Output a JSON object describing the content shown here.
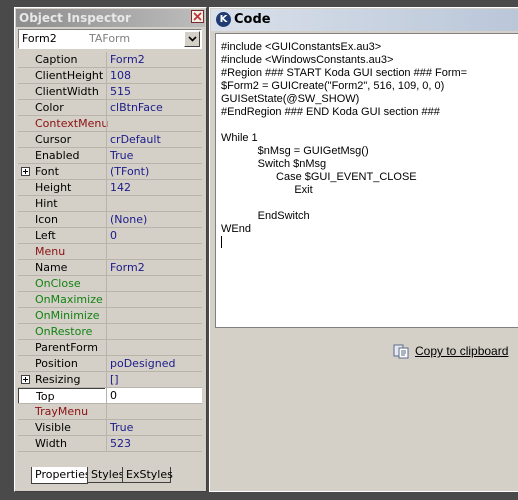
{
  "inspector": {
    "title": "Object Inspector",
    "selected_name": "Form2",
    "selected_type": "TAForm",
    "properties": [
      {
        "name": "Caption",
        "value": "Form2",
        "kind": "prop"
      },
      {
        "name": "ClientHeight",
        "value": "108",
        "kind": "prop"
      },
      {
        "name": "ClientWidth",
        "value": "515",
        "kind": "prop"
      },
      {
        "name": "Color",
        "value": "clBtnFace",
        "kind": "prop"
      },
      {
        "name": "ContextMenu",
        "value": "",
        "kind": "comp"
      },
      {
        "name": "Cursor",
        "value": "crDefault",
        "kind": "prop"
      },
      {
        "name": "Enabled",
        "value": "True",
        "kind": "prop"
      },
      {
        "name": "Font",
        "value": "(TFont)",
        "kind": "prop",
        "expandable": true
      },
      {
        "name": "Height",
        "value": "142",
        "kind": "prop"
      },
      {
        "name": "Hint",
        "value": "",
        "kind": "prop"
      },
      {
        "name": "Icon",
        "value": "(None)",
        "kind": "prop"
      },
      {
        "name": "Left",
        "value": "0",
        "kind": "prop"
      },
      {
        "name": "Menu",
        "value": "",
        "kind": "comp"
      },
      {
        "name": "Name",
        "value": "Form2",
        "kind": "prop"
      },
      {
        "name": "OnClose",
        "value": "",
        "kind": "event"
      },
      {
        "name": "OnMaximize",
        "value": "",
        "kind": "event"
      },
      {
        "name": "OnMinimize",
        "value": "",
        "kind": "event"
      },
      {
        "name": "OnRestore",
        "value": "",
        "kind": "event"
      },
      {
        "name": "ParentForm",
        "value": "",
        "kind": "prop"
      },
      {
        "name": "Position",
        "value": "poDesigned",
        "kind": "prop"
      },
      {
        "name": "Resizing",
        "value": "[]",
        "kind": "prop",
        "expandable": true
      },
      {
        "name": "Top",
        "value": "0",
        "kind": "prop",
        "selected": true
      },
      {
        "name": "TrayMenu",
        "value": "",
        "kind": "comp"
      },
      {
        "name": "Visible",
        "value": "True",
        "kind": "prop"
      },
      {
        "name": "Width",
        "value": "523",
        "kind": "prop"
      }
    ],
    "tabs": [
      "Properties",
      "Styles",
      "ExStyles"
    ],
    "active_tab": "Properties"
  },
  "code_window": {
    "title": "Code",
    "lines": [
      "#include <GUIConstantsEx.au3>",
      "#include <WindowsConstants.au3>",
      "#Region ### START Koda GUI section ### Form=",
      "$Form2 = GUICreate(\"Form2\", 516, 109, 0, 0)",
      "GUISetState(@SW_SHOW)",
      "#EndRegion ### END Koda GUI section ###",
      "",
      "While 1",
      "\t\t$nMsg = GUIGetMsg()",
      "\t\tSwitch $nMsg",
      "\t\t\tCase $GUI_EVENT_CLOSE",
      "\t\t\t\tExit",
      "",
      "\t\tEndSwitch",
      "WEnd"
    ],
    "copy_label": "Copy to clipboard"
  },
  "colors": {
    "event_text": "#128212",
    "component_text": "#8b1010",
    "value_text": "#1b1b8a"
  }
}
